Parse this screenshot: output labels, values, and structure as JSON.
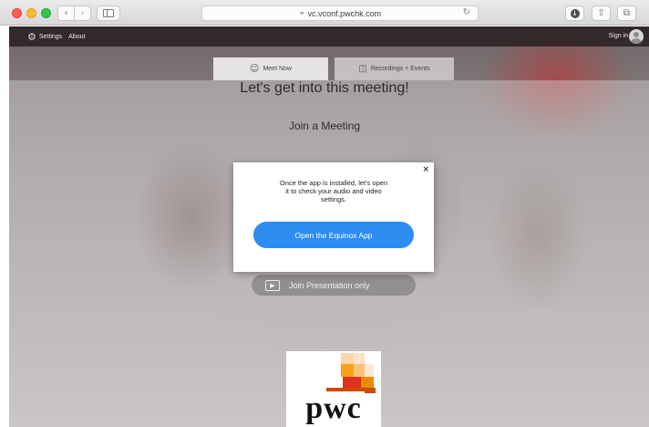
{
  "browser": {
    "url": "vc.vconf.pwchk.com",
    "icons": {
      "back": "chevron-left-icon",
      "forward": "chevron-right-icon",
      "sidebar": "sidebar-icon",
      "lock": "lock-icon",
      "reload": "reload-icon",
      "download": "download-icon",
      "share": "share-icon",
      "tabs": "tabs-icon"
    }
  },
  "appbar": {
    "settings_label": "Settings",
    "about_label": "About",
    "signin_label": "Sign in"
  },
  "tabs": [
    {
      "label": "Meet Now",
      "icon": "people-icon",
      "active": true
    },
    {
      "label": "Recordings + Events",
      "icon": "video-icon",
      "active": false
    }
  ],
  "main": {
    "headline": "Let's get into this meeting!",
    "subhead": "Join a Meeting",
    "presentation_button": "Join Presentation only"
  },
  "modal": {
    "message": "Once the app is installed, let's open it to check your audio and video settings.",
    "primary_button": "Open the Equinox App",
    "close_label": "×"
  },
  "logo": {
    "text": "pwc"
  },
  "colors": {
    "accent": "#2d8cf0",
    "appbar": "#2e2426",
    "logo_orange": "#f7a11a",
    "logo_red": "#d04a02"
  }
}
